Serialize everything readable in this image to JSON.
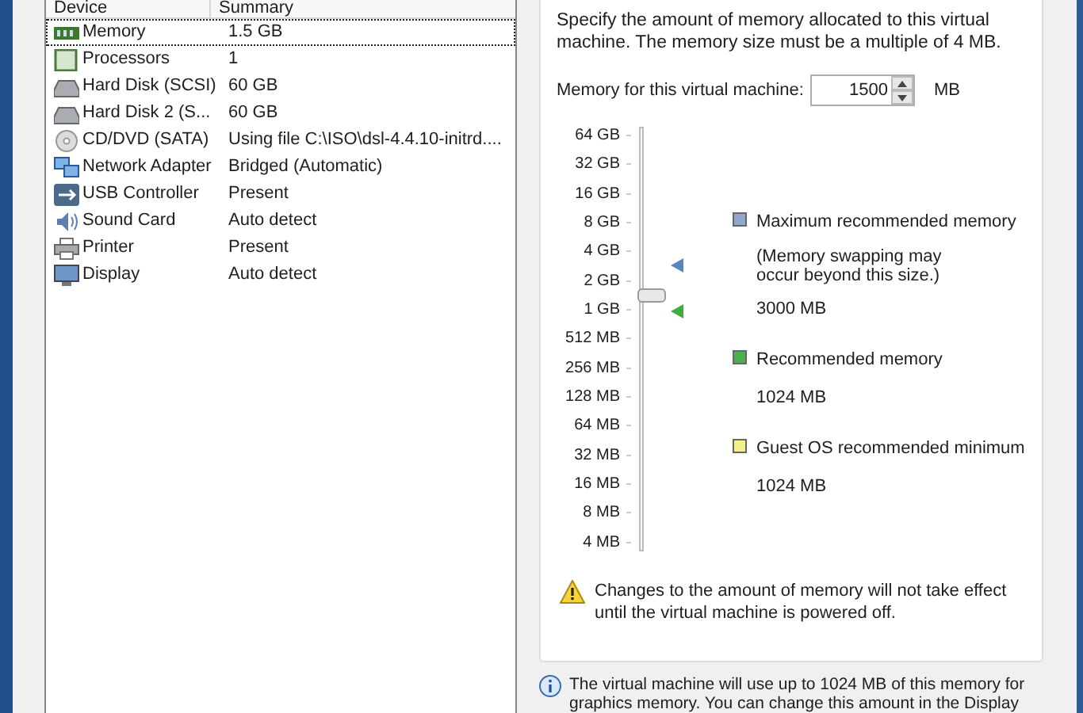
{
  "device_list": {
    "columns": [
      "Device",
      "Summary"
    ],
    "rows": [
      {
        "kind": "memory",
        "device": "Memory",
        "summary": "1.5 GB",
        "selected": true
      },
      {
        "kind": "cpu",
        "device": "Processors",
        "summary": "1",
        "selected": false
      },
      {
        "kind": "disk",
        "device": "Hard Disk (SCSI)",
        "summary": "60 GB",
        "selected": false
      },
      {
        "kind": "disk",
        "device": "Hard Disk 2 (S...",
        "summary": "60 GB",
        "selected": false
      },
      {
        "kind": "disc",
        "device": "CD/DVD (SATA)",
        "summary": "Using file C:\\ISO\\dsl-4.4.10-initrd....",
        "selected": false
      },
      {
        "kind": "network",
        "device": "Network Adapter",
        "summary": "Bridged (Automatic)",
        "selected": false
      },
      {
        "kind": "usb",
        "device": "USB Controller",
        "summary": "Present",
        "selected": false
      },
      {
        "kind": "sound",
        "device": "Sound Card",
        "summary": "Auto detect",
        "selected": false
      },
      {
        "kind": "printer",
        "device": "Printer",
        "summary": "Present",
        "selected": false
      },
      {
        "kind": "display",
        "device": "Display",
        "summary": "Auto detect",
        "selected": false
      }
    ]
  },
  "memory": {
    "description": "Specify the amount of memory allocated to this virtual machine. The memory size must be a multiple of 4 MB.",
    "field_label": "Memory for this virtual machine:",
    "value": "1500",
    "unit": "MB",
    "slider": {
      "ticks": [
        "64 GB",
        "32 GB",
        "16 GB",
        "8 GB",
        "4 GB",
        "2 GB",
        "1 GB",
        "512 MB",
        "256 MB",
        "128 MB",
        "64 MB",
        "32 MB",
        "16 MB",
        "8 MB",
        "4 MB"
      ],
      "level": 0.61,
      "markers": [
        {
          "color": "#5b86c4",
          "level": 0.683
        },
        {
          "color": "#3fae3f",
          "level": 0.571
        }
      ]
    },
    "legend": [
      {
        "color": "#8fa9cc",
        "title": "Maximum recommended memory",
        "note": "(Memory swapping may occur beyond this size.)",
        "value": "3000 MB"
      },
      {
        "color": "#4caf50",
        "title": "Recommended memory",
        "value": "1024 MB"
      },
      {
        "color": "#f5f08a",
        "title": "Guest OS recommended minimum",
        "value": "1024 MB"
      }
    ],
    "warning": "Changes to the amount of memory will not take effect until the virtual machine is powered off.",
    "info": "The virtual machine will use up to 1024 MB of this memory for graphics memory. You can change this amount in the Display"
  }
}
